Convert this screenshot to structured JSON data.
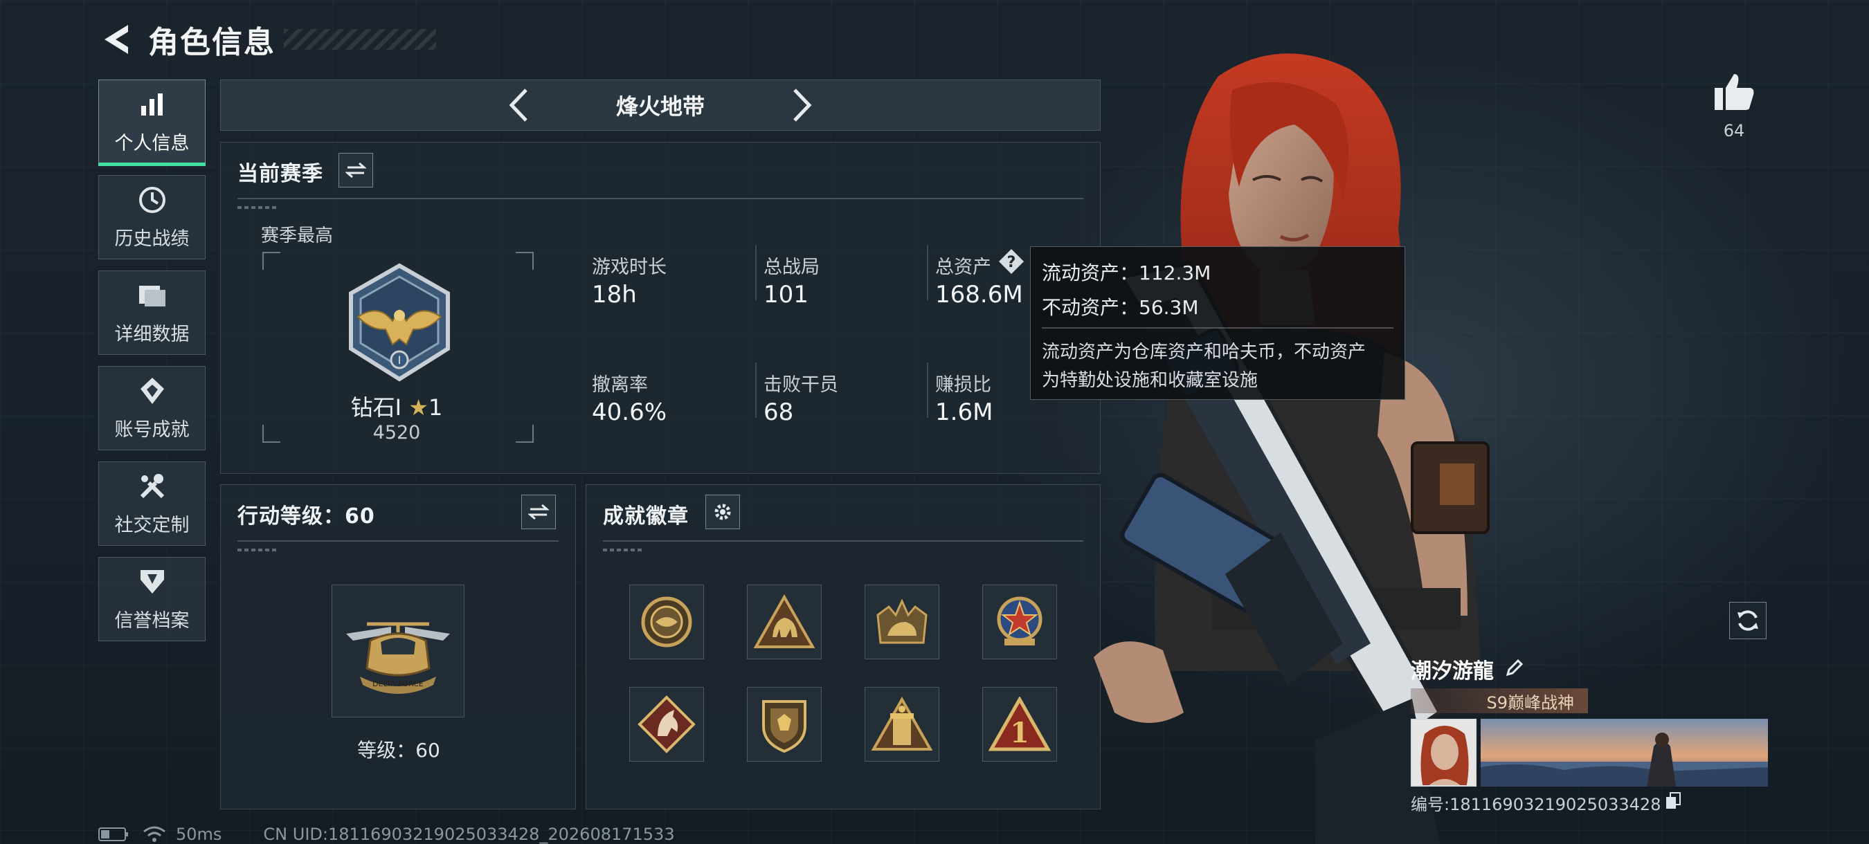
{
  "header": {
    "title": "角色信息"
  },
  "sidebar": {
    "items": [
      {
        "label": "个人信息",
        "icon": "bar-chart-icon",
        "active": true
      },
      {
        "label": "历史战绩",
        "icon": "history-icon",
        "active": false
      },
      {
        "label": "详细数据",
        "icon": "folder-icon",
        "active": false
      },
      {
        "label": "账号成就",
        "icon": "achievement-icon",
        "active": false
      },
      {
        "label": "社交定制",
        "icon": "tools-icon",
        "active": false
      },
      {
        "label": "信誉档案",
        "icon": "shield-icon",
        "active": false
      }
    ]
  },
  "mode": {
    "name": "烽火地带"
  },
  "season": {
    "title": "当前赛季",
    "best_label": "赛季最高",
    "rank_name": "钻石Ⅰ",
    "rank_stars": "1",
    "rank_score": "4520",
    "stats": [
      {
        "label": "游戏时长",
        "value": "18h"
      },
      {
        "label": "总战局",
        "value": "101"
      },
      {
        "label": "总资产",
        "value": "168.6M"
      },
      {
        "label": "撤离率",
        "value": "40.6%"
      },
      {
        "label": "击败干员",
        "value": "68"
      },
      {
        "label": "赚损比",
        "value": "1.6M"
      }
    ]
  },
  "tooltip": {
    "liquid": "流动资产：112.3M",
    "fixed": "不动资产：56.3M",
    "desc_line1": "流动资产为仓库资产和哈夫币，不动资产",
    "desc_line2": "为特勤处设施和收藏室设施"
  },
  "action_level": {
    "title": "行动等级：60",
    "level_text": "等级：60",
    "emblem_text": "DELTA FORCE"
  },
  "achievements": {
    "title": "成就徽章",
    "badge_icons": [
      "eye-badge-icon",
      "elephant-badge-icon",
      "rhino-badge-icon",
      "star-badge-icon",
      "horse-badge-icon",
      "shield-badge-icon",
      "tower-badge-icon",
      "number-one-badge-icon"
    ],
    "badge_six_label": "1"
  },
  "player": {
    "likes": "64",
    "name": "潮汐游龍",
    "title": "S9巅峰战神",
    "id_text": "编号:18116903219025033428"
  },
  "status": {
    "ping": "50ms",
    "uid": "CN UID:18116903219025033428_202608171533"
  },
  "colors": {
    "accent": "#3fe0a0",
    "gold": "#c9a25a",
    "hair": "#b5331f"
  }
}
